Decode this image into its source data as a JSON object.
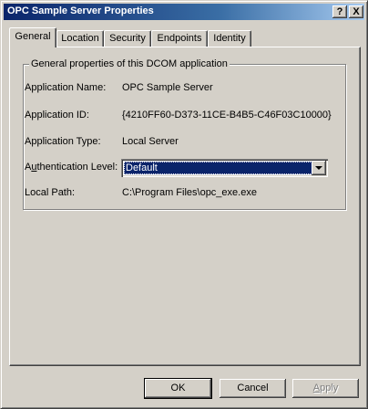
{
  "window": {
    "title": "OPC Sample Server Properties",
    "help_label": "?",
    "close_label": "X"
  },
  "tabs": [
    {
      "label": "General",
      "active": true
    },
    {
      "label": "Location",
      "active": false
    },
    {
      "label": "Security",
      "active": false
    },
    {
      "label": "Endpoints",
      "active": false
    },
    {
      "label": "Identity",
      "active": false
    }
  ],
  "group": {
    "legend": "General properties of this DCOM application"
  },
  "fields": {
    "app_name_label": "Application Name:",
    "app_name_value": "OPC Sample Server",
    "app_id_label": "Application ID:",
    "app_id_value": "{4210FF60-D373-11CE-B4B5-C46F03C10000}",
    "app_type_label": "Application Type:",
    "app_type_value": "Local Server",
    "auth_label_prefix": "A",
    "auth_label_underlined": "u",
    "auth_label_suffix": "thentication Level:",
    "auth_value": "Default",
    "local_path_label": "Local Path:",
    "local_path_value": "C:\\Program Files\\opc_exe.exe"
  },
  "buttons": {
    "ok": "OK",
    "cancel": "Cancel",
    "apply_prefix": "",
    "apply_underlined": "A",
    "apply_suffix": "pply"
  },
  "colors": {
    "title_start": "#0a246a",
    "title_end": "#a6caf0",
    "face": "#d4d0c8",
    "selection": "#0a246a"
  },
  "icons": {
    "dropdown": "chevron-down-icon"
  }
}
